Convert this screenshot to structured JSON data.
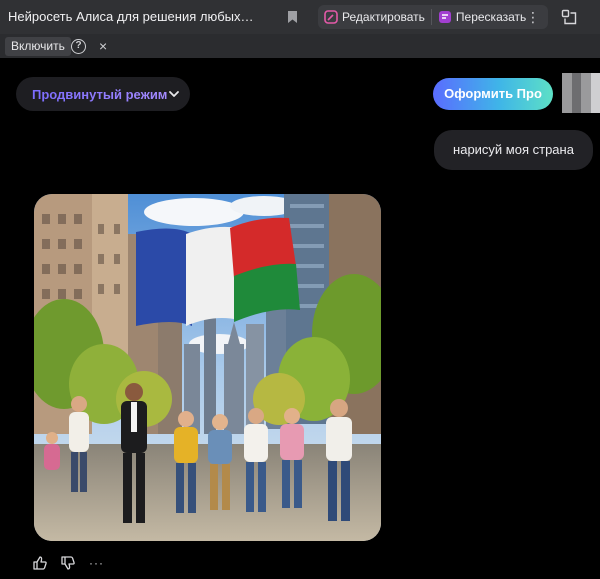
{
  "browser": {
    "tab_title": "Нейросеть Алиса для решения любых…",
    "edit_label": "Редактировать",
    "retell_label": "Пересказать"
  },
  "subbar": {
    "enable_label": "Включить",
    "help_label": "?",
    "close_label": "×"
  },
  "chat": {
    "mode_label": "Продвинутый режим",
    "pro_button_label": "Оформить Про",
    "user_message": "нарисуй моя страна",
    "generated_image": {
      "flag_colors": [
        "#2b4aa8",
        "#f0f0f0",
        "#d42a2a",
        "#1f8a3a"
      ]
    },
    "actions": {
      "more_label": "···"
    }
  },
  "colors": {
    "accent_purple": "#7b6cff",
    "pro_gradient_start": "#5a6cff",
    "pro_gradient_end": "#5de0c6"
  }
}
